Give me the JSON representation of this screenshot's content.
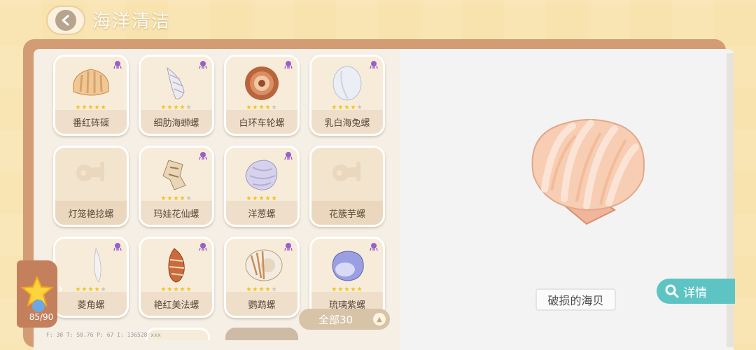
{
  "header": {
    "title": "海洋清洁"
  },
  "cards": [
    {
      "name": "番红砗磲",
      "stars": 5,
      "locked": false
    },
    {
      "name": "细肋海蛳螺",
      "stars": 4,
      "locked": false
    },
    {
      "name": "白环车轮螺",
      "stars": 4,
      "locked": false
    },
    {
      "name": "乳白海兔螺",
      "stars": 4,
      "locked": false
    },
    {
      "name": "灯笼艳捻螺",
      "stars": 0,
      "locked": true
    },
    {
      "name": "玛娃花仙螺",
      "stars": 4,
      "locked": false
    },
    {
      "name": "洋葱螺",
      "stars": 5,
      "locked": false
    },
    {
      "name": "花簇芋螺",
      "stars": 0,
      "locked": true
    },
    {
      "name": "菱角螺",
      "stars": 4,
      "locked": false
    },
    {
      "name": "艳红美法螺",
      "stars": 5,
      "locked": false
    },
    {
      "name": "鹦鹉螺",
      "stars": 4,
      "locked": false
    },
    {
      "name": "琉璃紫螺",
      "stars": 5,
      "locked": false
    }
  ],
  "collection": {
    "count": "85/90"
  },
  "filter": {
    "label": "全部30"
  },
  "detail": {
    "item_name": "破损的海贝",
    "detail_label": "详情"
  },
  "debug_text": "F: 30   T: 50.76   P: 67   I: 136528 xxx",
  "colors": {
    "accent": "#5ec4c3",
    "book": "#d39c74",
    "star": "#f1c21b"
  }
}
